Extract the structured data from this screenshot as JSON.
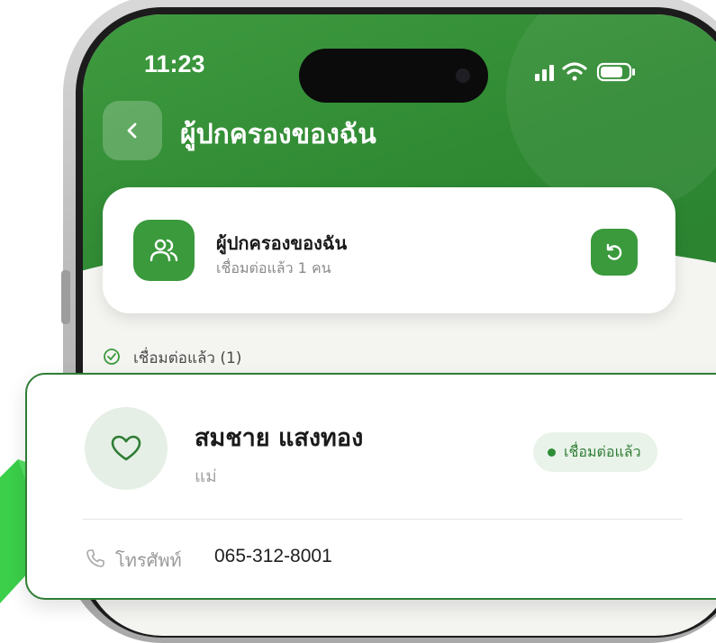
{
  "status_bar": {
    "time": "11:23"
  },
  "header": {
    "title": "ผู้ปกครองของฉัน"
  },
  "summary": {
    "title": "ผู้ปกครองของฉัน",
    "subtitle": "เชื่อมต่อแล้ว 1 คน"
  },
  "section": {
    "label": "เชื่อมต่อแล้ว (1)"
  },
  "contact": {
    "name": "สมชาย แสงทอง",
    "relation": "แม่",
    "status": "เชื่อมต่อแล้ว",
    "phone_label": "โทรศัพท์",
    "phone": "065-312-8001"
  },
  "colors": {
    "brand_green": "#2f8a33",
    "accent_green": "#3a9a3c",
    "badge_bg": "#e9f3e9",
    "highlight_border": "#2f7d35"
  },
  "icons": [
    "back-icon",
    "guardians-icon",
    "refresh-icon",
    "check-circle-icon",
    "heart-icon",
    "phone-icon",
    "signal-icon",
    "wifi-icon",
    "battery-icon"
  ]
}
